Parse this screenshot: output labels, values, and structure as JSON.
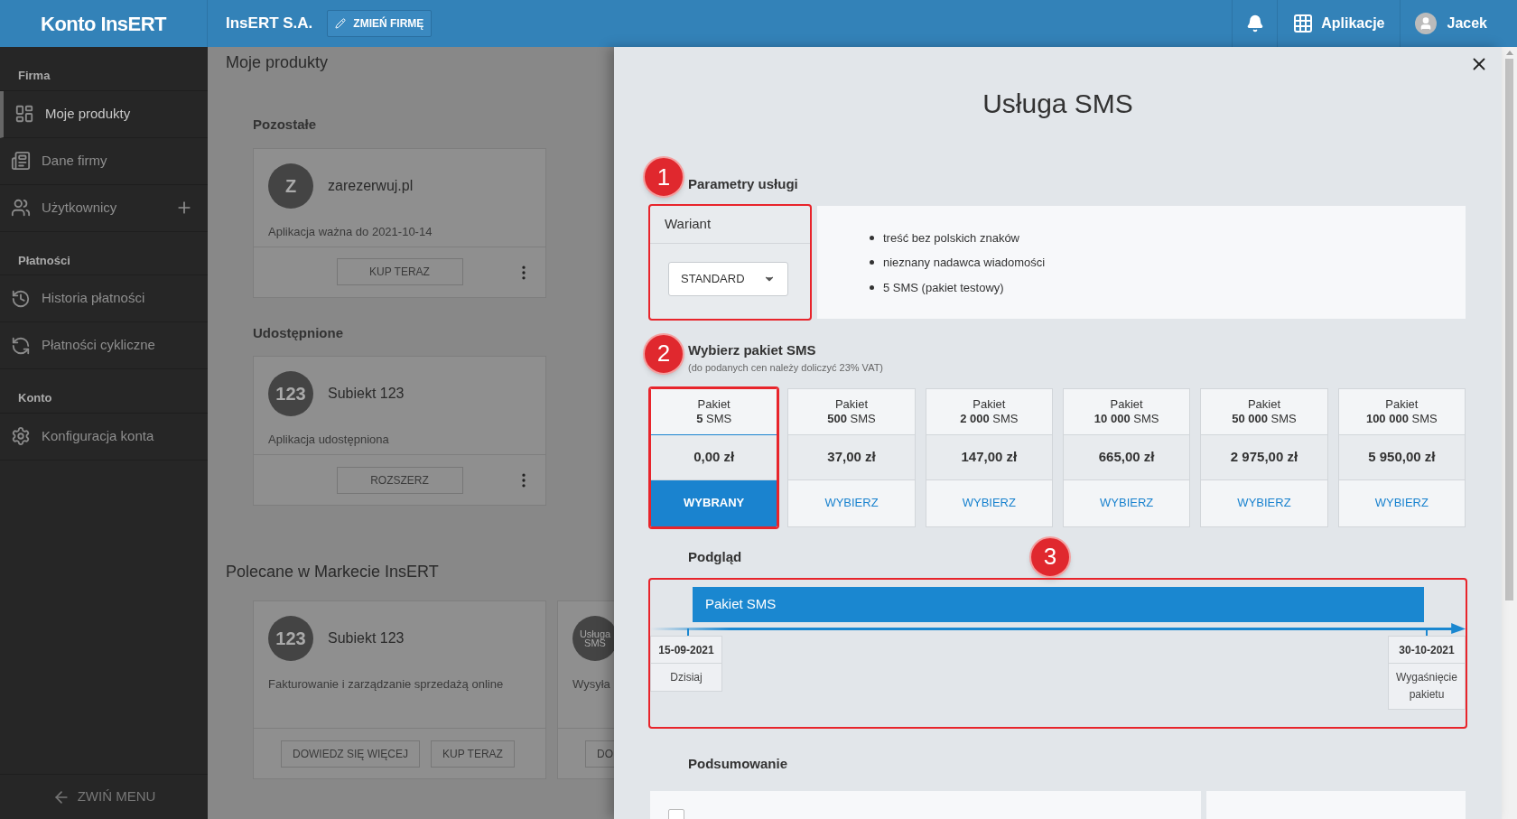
{
  "topbar": {
    "brand": "Konto InsERT",
    "company": "InsERT S.A.",
    "change_button": "ZMIEŃ FIRMĘ",
    "apps": "Aplikacje",
    "user": "Jacek"
  },
  "sidebar": {
    "sections": [
      {
        "title": "Firma",
        "items": [
          {
            "label": "Moje produkty",
            "selected": true,
            "add": false
          },
          {
            "label": "Dane firmy",
            "selected": false,
            "add": false
          },
          {
            "label": "Użytkownicy",
            "selected": false,
            "add": true
          }
        ]
      },
      {
        "title": "Płatności",
        "items": [
          {
            "label": "Historia płatności",
            "selected": false,
            "add": false
          },
          {
            "label": "Płatności cykliczne",
            "selected": false,
            "add": false
          }
        ]
      },
      {
        "title": "Konto",
        "items": [
          {
            "label": "Konfiguracja konta",
            "selected": false,
            "add": false
          }
        ]
      }
    ],
    "collapse": "ZWIŃ MENU"
  },
  "main": {
    "title": "Moje produkty",
    "groups": [
      {
        "title": "Pozostałe",
        "cards": [
          {
            "avatar": "Z",
            "name": "zarezerwuj.pl",
            "description": "Aplikacja ważna do 2021-10-14",
            "buttons": [
              "KUP TERAZ"
            ],
            "menu": true
          }
        ]
      },
      {
        "title": "Udostępnione",
        "cards": [
          {
            "avatar": "123",
            "name": "Subiekt 123",
            "description": "Aplikacja udostępniona",
            "buttons": [
              "ROZSZERZ"
            ],
            "menu": true
          }
        ]
      }
    ],
    "recommended": {
      "title": "Polecane w Markecie InsERT",
      "cards": [
        {
          "avatar": "123",
          "name": "Subiekt 123",
          "description": "Fakturowanie i zarządzanie sprzedażą online",
          "buttons": [
            "DOWIEDZ SIĘ WIĘCEJ",
            "KUP TERAZ"
          ],
          "menu": false
        },
        {
          "avatar": "Usługa SMS",
          "description": "Wysyła",
          "buttons": [
            "DO"
          ],
          "menu": false
        }
      ]
    }
  },
  "panel": {
    "title": "Usługa SMS",
    "params": {
      "heading": "Parametry usługi",
      "variant_label": "Wariant",
      "variant_value": "STANDARD",
      "features": [
        "treść bez polskich znaków",
        "nieznany nadawca wiadomości",
        "5 SMS (pakiet testowy)"
      ]
    },
    "packages": {
      "heading": "Wybierz pakiet SMS",
      "note": "(do podanych cen należy doliczyć 23% VAT)",
      "items": [
        {
          "label": "Pakiet",
          "count": "5",
          "unit": "SMS",
          "price": "0,00 zł",
          "action": "WYBRANY",
          "selected": true
        },
        {
          "label": "Pakiet",
          "count": "500",
          "unit": "SMS",
          "price": "37,00 zł",
          "action": "WYBIERZ",
          "selected": false
        },
        {
          "label": "Pakiet",
          "count": "2 000",
          "unit": "SMS",
          "price": "147,00 zł",
          "action": "WYBIERZ",
          "selected": false
        },
        {
          "label": "Pakiet",
          "count": "10 000",
          "unit": "SMS",
          "price": "665,00 zł",
          "action": "WYBIERZ",
          "selected": false
        },
        {
          "label": "Pakiet",
          "count": "50 000",
          "unit": "SMS",
          "price": "2 975,00 zł",
          "action": "WYBIERZ",
          "selected": false
        },
        {
          "label": "Pakiet",
          "count": "100 000",
          "unit": "SMS",
          "price": "5 950,00 zł",
          "action": "WYBIERZ",
          "selected": false
        }
      ]
    },
    "preview": {
      "heading": "Podgląd",
      "bar": "Pakiet SMS",
      "start": {
        "date": "15-09-2021",
        "label": "Dzisiaj"
      },
      "end": {
        "date": "30-10-2021",
        "label": "Wygaśnięcie pakietu"
      }
    },
    "summary": {
      "heading": "Podsumowanie",
      "accept_checked": false
    },
    "annotations": [
      "1",
      "2",
      "3"
    ]
  }
}
